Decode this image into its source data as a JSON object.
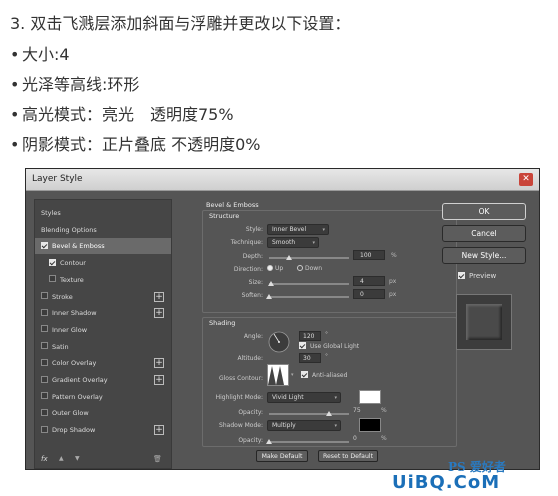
{
  "instructions": {
    "heading": "3. 双击飞溅层添加斜面与浮雕并更改以下设置：",
    "bullet_char": "•",
    "items": [
      "大小:4",
      "光泽等高线:环形",
      "高光模式：亮光　透明度75%",
      "阴影模式：正片叠底 不透明度0%"
    ]
  },
  "dialog": {
    "title": "Layer Style",
    "close_glyph": "✕",
    "left_panel": {
      "items": [
        {
          "label": "Styles",
          "checkbox": false,
          "checked": false,
          "plus": false,
          "selected": false
        },
        {
          "label": "Blending Options",
          "checkbox": false,
          "checked": false,
          "plus": false,
          "selected": false
        },
        {
          "label": "Bevel & Emboss",
          "checkbox": true,
          "checked": true,
          "plus": false,
          "selected": true
        },
        {
          "label": "Contour",
          "checkbox": true,
          "checked": true,
          "plus": false,
          "selected": false,
          "indent": true
        },
        {
          "label": "Texture",
          "checkbox": true,
          "checked": false,
          "plus": false,
          "selected": false,
          "indent": true
        },
        {
          "label": "Stroke",
          "checkbox": true,
          "checked": false,
          "plus": true,
          "selected": false
        },
        {
          "label": "Inner Shadow",
          "checkbox": true,
          "checked": false,
          "plus": true,
          "selected": false
        },
        {
          "label": "Inner Glow",
          "checkbox": true,
          "checked": false,
          "plus": false,
          "selected": false
        },
        {
          "label": "Satin",
          "checkbox": true,
          "checked": false,
          "plus": false,
          "selected": false
        },
        {
          "label": "Color Overlay",
          "checkbox": true,
          "checked": false,
          "plus": true,
          "selected": false
        },
        {
          "label": "Gradient Overlay",
          "checkbox": true,
          "checked": false,
          "plus": true,
          "selected": false
        },
        {
          "label": "Pattern Overlay",
          "checkbox": true,
          "checked": false,
          "plus": false,
          "selected": false
        },
        {
          "label": "Outer Glow",
          "checkbox": true,
          "checked": false,
          "plus": false,
          "selected": false
        },
        {
          "label": "Drop Shadow",
          "checkbox": true,
          "checked": false,
          "plus": true,
          "selected": false
        }
      ],
      "fx_label": "fx",
      "up_glyph": "▲",
      "down_glyph": "▼",
      "trash_glyph": "🗑"
    },
    "bevel": {
      "title": "Bevel & Emboss",
      "structure_title": "Structure",
      "style_label": "Style:",
      "style_value": "Inner Bevel",
      "technique_label": "Technique:",
      "technique_value": "Smooth",
      "depth_label": "Depth:",
      "depth_value": "100",
      "depth_unit": "%",
      "depth_level": 0.25,
      "direction_label": "Direction:",
      "direction_up": "Up",
      "direction_down": "Down",
      "size_label": "Size:",
      "size_value": "4",
      "size_unit": "px",
      "size_level": 0.03,
      "soften_label": "Soften:",
      "soften_value": "0",
      "soften_unit": "px",
      "soften_level": 0.0,
      "shading_title": "Shading",
      "angle_label": "Angle:",
      "angle_value": "120",
      "angle_unit": "°",
      "global_light_label": "Use Global Light",
      "altitude_label": "Altitude:",
      "altitude_value": "30",
      "altitude_unit": "°",
      "gloss_label": "Gloss Contour:",
      "anti_alias_label": "Anti-aliased",
      "highlight_label": "Highlight Mode:",
      "highlight_value": "Vivid Light",
      "highlight_color": "#ffffff",
      "hl_opacity_label": "Opacity:",
      "hl_opacity_value": "75",
      "hl_opacity_unit": "%",
      "hl_opacity_level": 0.75,
      "shadow_label": "Shadow Mode:",
      "shadow_value": "Multiply",
      "shadow_color": "#000000",
      "sh_opacity_label": "Opacity:",
      "sh_opacity_value": "0",
      "sh_opacity_unit": "%",
      "sh_opacity_level": 0.0,
      "make_default": "Make Default",
      "reset_default": "Reset to Default"
    },
    "right": {
      "ok": "OK",
      "cancel": "Cancel",
      "new_style": "New Style...",
      "preview_label": "Preview"
    }
  },
  "watermark": {
    "line1": "PS 爱好者",
    "line2": "UiBQ.CoM"
  }
}
